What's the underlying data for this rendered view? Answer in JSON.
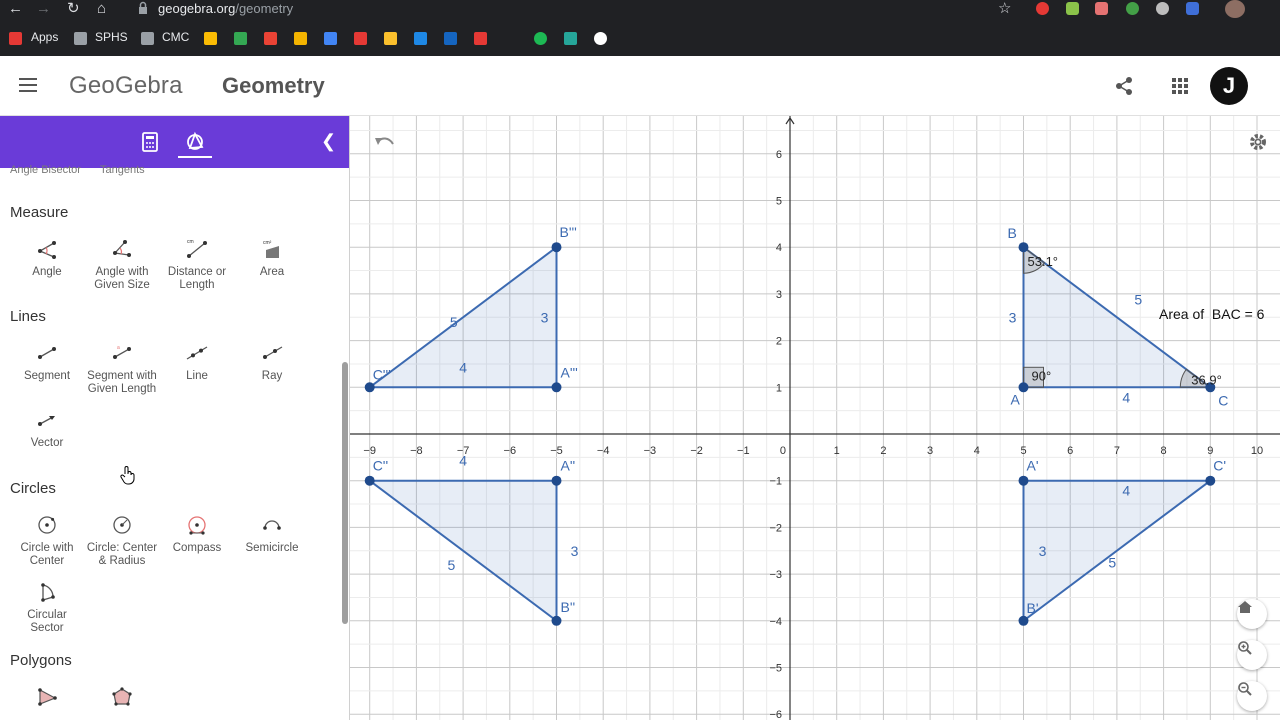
{
  "browser": {
    "url_host": "geogebra.org",
    "url_path": "/geometry",
    "bookmarks": [
      "Apps",
      "SPHS",
      "CMC"
    ]
  },
  "header": {
    "logo": "GeoGebra",
    "app_title": "Geometry",
    "avatar_letter": "J"
  },
  "sidebar": {
    "cutoff_labels": [
      "Angle Bisector",
      "Tangents"
    ],
    "sections": [
      {
        "title": "Measure",
        "tools": [
          "Angle",
          "Angle with Given Size",
          "Distance or Length",
          "Area"
        ]
      },
      {
        "title": "Lines",
        "tools": [
          "Segment",
          "Segment with Given Length",
          "Line",
          "Ray",
          "Vector"
        ]
      },
      {
        "title": "Circles",
        "tools": [
          "Circle with Center",
          "Circle: Center & Radius",
          "Compass",
          "Semicircle",
          "Circular Sector"
        ]
      },
      {
        "title": "Polygons",
        "tools": []
      }
    ]
  },
  "graph": {
    "x_axis": {
      "min": -9,
      "max": 10,
      "labels": [
        "−9",
        "−8",
        "−7",
        "−6",
        "−5",
        "−4",
        "−3",
        "−2",
        "−1",
        "0",
        "1",
        "2",
        "3",
        "4",
        "5",
        "6",
        "7",
        "8",
        "9",
        "10"
      ]
    },
    "y_axis": {
      "min": -6,
      "max": 6,
      "labels": [
        "6",
        "5",
        "4",
        "3",
        "2",
        "1",
        "−1",
        "−2",
        "−3",
        "−4",
        "−5",
        "−6"
      ]
    },
    "points": [
      {
        "label": "A",
        "x": 5,
        "y": 1
      },
      {
        "label": "B",
        "x": 5,
        "y": 4
      },
      {
        "label": "C",
        "x": 9,
        "y": 1
      },
      {
        "label": "A'",
        "x": 5,
        "y": -1
      },
      {
        "label": "B'",
        "x": 5,
        "y": -4
      },
      {
        "label": "C'",
        "x": 9,
        "y": -1
      },
      {
        "label": "A''",
        "x": -5,
        "y": -1
      },
      {
        "label": "B''",
        "x": -5,
        "y": -4
      },
      {
        "label": "C''",
        "x": -9,
        "y": -1
      },
      {
        "label": "A'''",
        "x": -5,
        "y": 1
      },
      {
        "label": "B'''",
        "x": -5,
        "y": 4
      },
      {
        "label": "C'''",
        "x": -9,
        "y": 1
      }
    ],
    "triangles": [
      {
        "name": "ABC",
        "vertices": [
          "A",
          "B",
          "C"
        ],
        "side_labels": {
          "AB": "3",
          "BC": "5",
          "AC": "4"
        }
      },
      {
        "name": "A'B'C'",
        "vertices": [
          "A'",
          "B'",
          "C'"
        ],
        "side_labels": {
          "AB": "3",
          "BC": "5",
          "AC": "4"
        }
      },
      {
        "name": "A''B''C''",
        "vertices": [
          "A''",
          "B''",
          "C''"
        ],
        "side_labels": {
          "AB": "3",
          "BC": "5",
          "AC": "4"
        }
      },
      {
        "name": "A'''B'''C'''",
        "vertices": [
          "A'''",
          "B'''",
          "C'''"
        ],
        "side_labels": {
          "AB": "3",
          "BC": "5",
          "AC": "4"
        }
      }
    ],
    "angle_labels": {
      "B": "53.1°",
      "A": "90°",
      "C": "36.9°"
    },
    "area_label": "Area of  BAC = 6"
  }
}
